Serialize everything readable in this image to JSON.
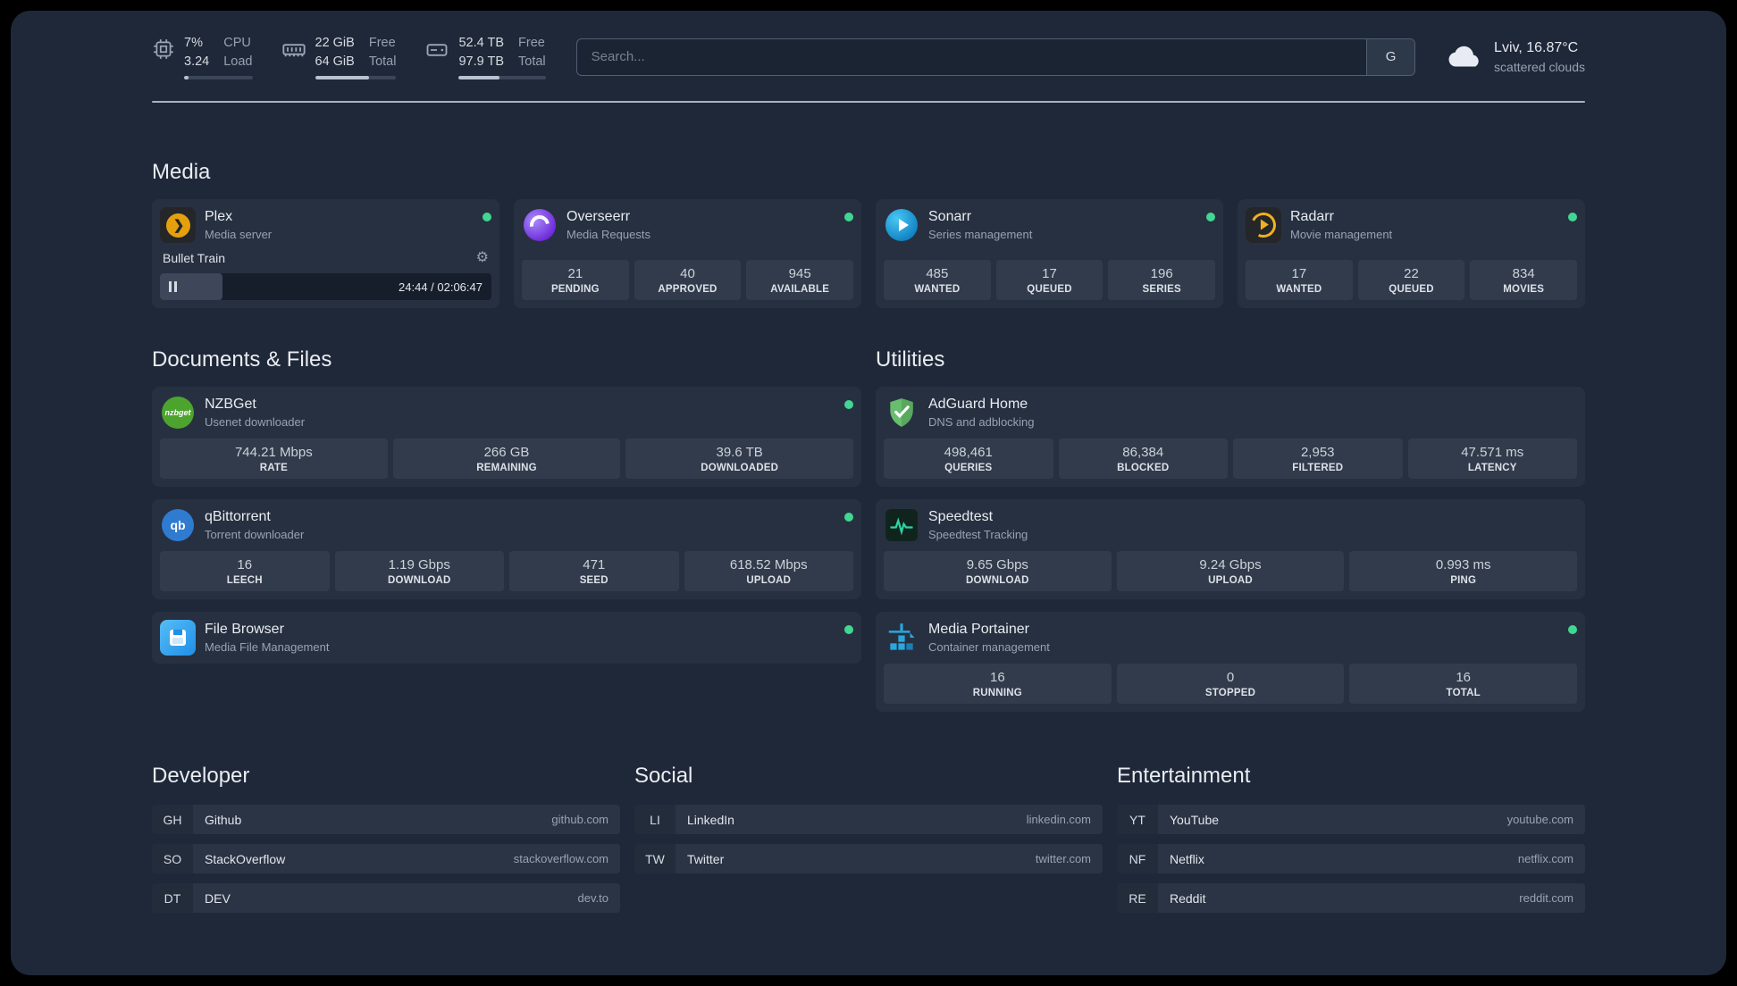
{
  "icons": {
    "plex_glyph": "❯",
    "gear_glyph": "⚙",
    "nzbget_text": "nzbget",
    "qbittorrent_text": "qb"
  },
  "topbar": {
    "cpu": {
      "percent": "7%",
      "load_value": "3.24",
      "label_top": "CPU",
      "label_bottom": "Load",
      "progress": 7
    },
    "memory": {
      "free": "22 GiB",
      "total": "64 GiB",
      "label_top": "Free",
      "label_bottom": "Total",
      "progress": 66
    },
    "disk": {
      "free": "52.4 TB",
      "total": "97.9 TB",
      "label_top": "Free",
      "label_bottom": "Total",
      "progress": 47
    },
    "search": {
      "placeholder": "Search...",
      "provider_label": "G"
    },
    "weather": {
      "location": "Lviv, 16.87°C",
      "condition": "scattered clouds"
    }
  },
  "sections": {
    "media": {
      "title": "Media",
      "plex": {
        "name": "Plex",
        "subtitle": "Media server",
        "now_playing": "Bullet Train",
        "time": "24:44 / 02:06:47",
        "progress": 19
      },
      "overseerr": {
        "name": "Overseerr",
        "subtitle": "Media Requests",
        "stats": [
          {
            "value": "21",
            "label": "PENDING"
          },
          {
            "value": "40",
            "label": "APPROVED"
          },
          {
            "value": "945",
            "label": "AVAILABLE"
          }
        ]
      },
      "sonarr": {
        "name": "Sonarr",
        "subtitle": "Series management",
        "stats": [
          {
            "value": "485",
            "label": "WANTED"
          },
          {
            "value": "17",
            "label": "QUEUED"
          },
          {
            "value": "196",
            "label": "SERIES"
          }
        ]
      },
      "radarr": {
        "name": "Radarr",
        "subtitle": "Movie management",
        "stats": [
          {
            "value": "17",
            "label": "WANTED"
          },
          {
            "value": "22",
            "label": "QUEUED"
          },
          {
            "value": "834",
            "label": "MOVIES"
          }
        ]
      }
    },
    "documents": {
      "title": "Documents & Files",
      "nzbget": {
        "name": "NZBGet",
        "subtitle": "Usenet downloader",
        "stats": [
          {
            "value": "744.21 Mbps",
            "label": "RATE"
          },
          {
            "value": "266 GB",
            "label": "REMAINING"
          },
          {
            "value": "39.6 TB",
            "label": "DOWNLOADED"
          }
        ]
      },
      "qbittorrent": {
        "name": "qBittorrent",
        "subtitle": "Torrent downloader",
        "stats": [
          {
            "value": "16",
            "label": "LEECH"
          },
          {
            "value": "1.19 Gbps",
            "label": "DOWNLOAD"
          },
          {
            "value": "471",
            "label": "SEED"
          },
          {
            "value": "618.52 Mbps",
            "label": "UPLOAD"
          }
        ]
      },
      "filebrowser": {
        "name": "File Browser",
        "subtitle": "Media File Management"
      }
    },
    "utilities": {
      "title": "Utilities",
      "adguard": {
        "name": "AdGuard Home",
        "subtitle": "DNS and adblocking",
        "stats": [
          {
            "value": "498,461",
            "label": "QUERIES"
          },
          {
            "value": "86,384",
            "label": "BLOCKED"
          },
          {
            "value": "2,953",
            "label": "FILTERED"
          },
          {
            "value": "47.571 ms",
            "label": "LATENCY"
          }
        ]
      },
      "speedtest": {
        "name": "Speedtest",
        "subtitle": "Speedtest Tracking",
        "stats": [
          {
            "value": "9.65 Gbps",
            "label": "DOWNLOAD"
          },
          {
            "value": "9.24 Gbps",
            "label": "UPLOAD"
          },
          {
            "value": "0.993 ms",
            "label": "PING"
          }
        ]
      },
      "portainer": {
        "name": "Media Portainer",
        "subtitle": "Container management",
        "stats": [
          {
            "value": "16",
            "label": "RUNNING"
          },
          {
            "value": "0",
            "label": "STOPPED"
          },
          {
            "value": "16",
            "label": "TOTAL"
          }
        ]
      }
    }
  },
  "bookmarks": {
    "developer": {
      "title": "Developer",
      "items": [
        {
          "abbr": "GH",
          "name": "Github",
          "url": "github.com"
        },
        {
          "abbr": "SO",
          "name": "StackOverflow",
          "url": "stackoverflow.com"
        },
        {
          "abbr": "DT",
          "name": "DEV",
          "url": "dev.to"
        }
      ]
    },
    "social": {
      "title": "Social",
      "items": [
        {
          "abbr": "LI",
          "name": "LinkedIn",
          "url": "linkedin.com"
        },
        {
          "abbr": "TW",
          "name": "Twitter",
          "url": "twitter.com"
        }
      ]
    },
    "entertainment": {
      "title": "Entertainment",
      "items": [
        {
          "abbr": "YT",
          "name": "YouTube",
          "url": "youtube.com"
        },
        {
          "abbr": "NF",
          "name": "Netflix",
          "url": "netflix.com"
        },
        {
          "abbr": "RE",
          "name": "Reddit",
          "url": "reddit.com"
        }
      ]
    }
  }
}
